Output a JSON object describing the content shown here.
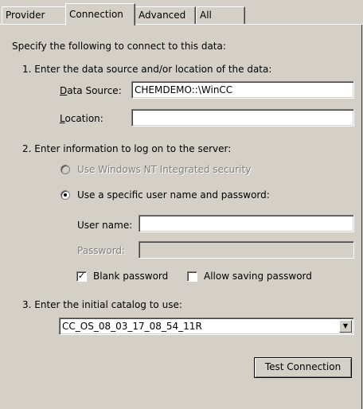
{
  "tabs": [
    {
      "label": "Provider"
    },
    {
      "label": "Connection"
    },
    {
      "label": "Advanced"
    },
    {
      "label": "All"
    }
  ],
  "intro": "Specify the following to connect to this data:",
  "step1": {
    "heading": "1. Enter the data source and/or location of the data:",
    "data_source_label": "Data Source:",
    "data_source_value": "CHEMDEMO::\\WinCC",
    "location_label": "Location:",
    "location_value": ""
  },
  "step2": {
    "heading": "2. Enter information to log on to the server:",
    "radio_nt": "Use Windows NT Integrated security",
    "radio_specific": "Use a specific user name and password:",
    "user_name_label": "User name:",
    "user_name_value": "",
    "password_label": "Password:",
    "password_value": "",
    "blank_password_label": "Blank password",
    "blank_password_checked": true,
    "allow_saving_label": "Allow saving password",
    "allow_saving_checked": false
  },
  "step3": {
    "heading": "3. Enter the initial catalog to use:",
    "catalog_value": "CC_OS_08_03_17_08_54_11R"
  },
  "test_button": "Test Connection"
}
